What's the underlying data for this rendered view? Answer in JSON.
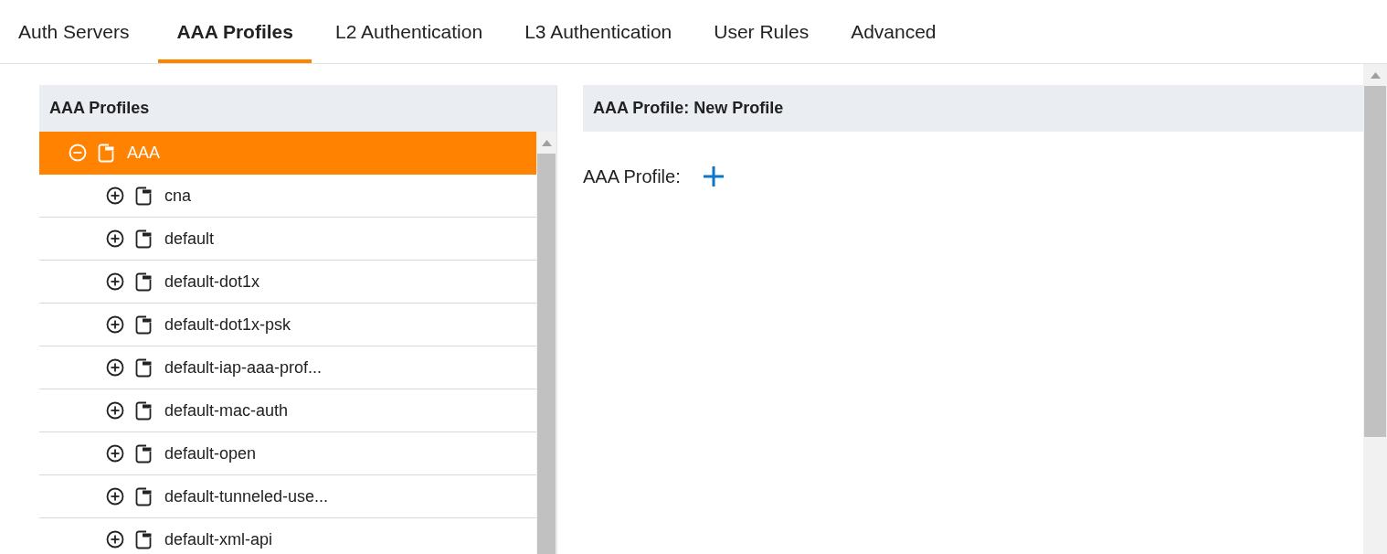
{
  "tabs": [
    {
      "label": "Auth Servers",
      "selected": false
    },
    {
      "label": "AAA Profiles",
      "selected": true
    },
    {
      "label": "L2 Authentication",
      "selected": false
    },
    {
      "label": "L3 Authentication",
      "selected": false
    },
    {
      "label": "User Rules",
      "selected": false
    },
    {
      "label": "Advanced",
      "selected": false
    }
  ],
  "profiles_panel": {
    "title": "AAA Profiles",
    "tree": [
      {
        "label": "AAA",
        "expanded": true,
        "selected": true,
        "children": [
          {
            "label": "cna",
            "expanded": false,
            "selected": false
          },
          {
            "label": "default",
            "expanded": false,
            "selected": false
          },
          {
            "label": "default-dot1x",
            "expanded": false,
            "selected": false
          },
          {
            "label": "default-dot1x-psk",
            "expanded": false,
            "selected": false
          },
          {
            "label": "default-iap-aaa-prof...",
            "expanded": false,
            "selected": false
          },
          {
            "label": "default-mac-auth",
            "expanded": false,
            "selected": false
          },
          {
            "label": "default-open",
            "expanded": false,
            "selected": false
          },
          {
            "label": "default-tunneled-use...",
            "expanded": false,
            "selected": false
          },
          {
            "label": "default-xml-api",
            "expanded": false,
            "selected": false
          }
        ]
      }
    ]
  },
  "detail_panel": {
    "title": "AAA Profile: New Profile",
    "field_label": "AAA Profile:"
  }
}
